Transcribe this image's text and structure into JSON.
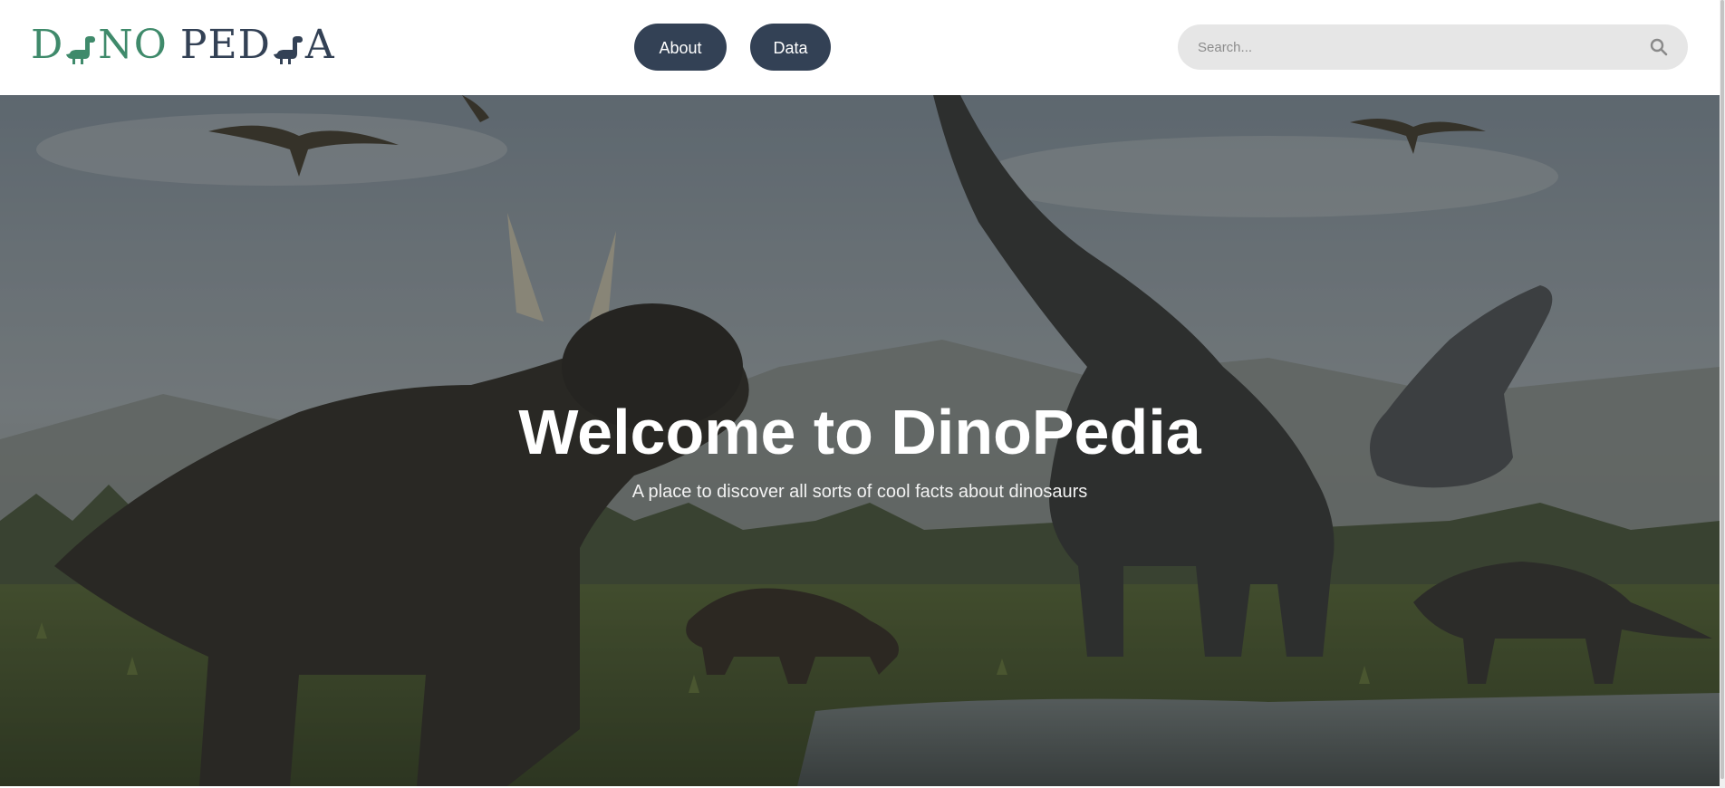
{
  "logo": {
    "part1": [
      "D",
      "NO"
    ],
    "part2": [
      "PED",
      "A"
    ],
    "colors": {
      "dino": "#3f8a6b",
      "pedia": "#334155"
    },
    "icon": "dinosaur-silhouette-icon"
  },
  "nav": {
    "about_label": "About",
    "data_label": "Data",
    "button_color": "#334155"
  },
  "search": {
    "placeholder": "Search...",
    "icon": "search-icon"
  },
  "hero": {
    "title": "Welcome to DinoPedia",
    "subtitle": "A place to discover all sorts of cool facts about dinosaurs"
  }
}
